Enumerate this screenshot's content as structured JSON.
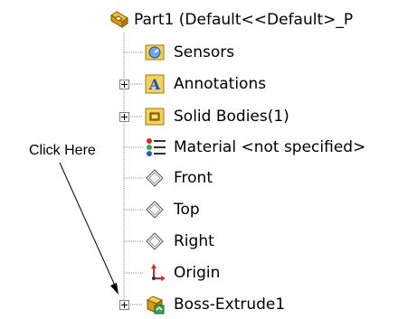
{
  "root": {
    "label": "Part1  (Default<<Default>_P"
  },
  "items": [
    {
      "label": "Sensors",
      "icon": "sensors-icon",
      "expandable": false
    },
    {
      "label": "Annotations",
      "icon": "annotations-icon",
      "expandable": true
    },
    {
      "label": "Solid Bodies(1)",
      "icon": "solid-bodies-icon",
      "expandable": true
    },
    {
      "label": "Material <not specified>",
      "icon": "material-icon",
      "expandable": false
    },
    {
      "label": "Front",
      "icon": "plane-icon",
      "expandable": false
    },
    {
      "label": "Top",
      "icon": "plane-icon",
      "expandable": false
    },
    {
      "label": "Right",
      "icon": "plane-icon",
      "expandable": false
    },
    {
      "label": "Origin",
      "icon": "origin-icon",
      "expandable": false
    },
    {
      "label": "Boss-Extrude1",
      "icon": "boss-extrude-icon",
      "expandable": true
    }
  ],
  "callout": {
    "text": "Click Here"
  },
  "colors": {
    "tree_line": "#808080",
    "folder_yellow": "#f4c020",
    "icon_blue": "#1f5fbf"
  }
}
